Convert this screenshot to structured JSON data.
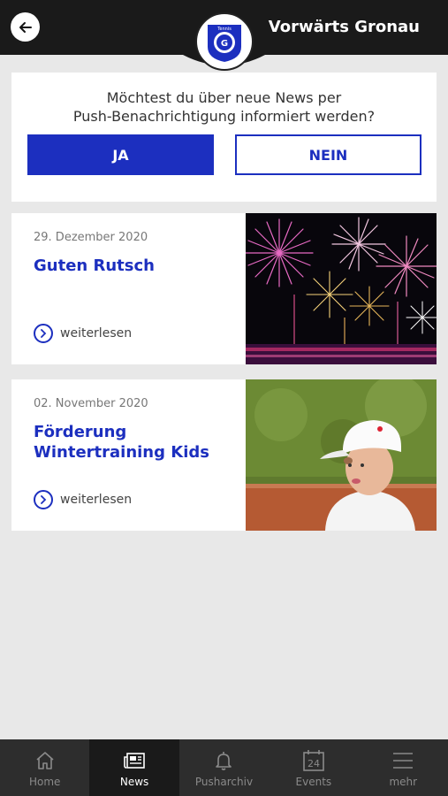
{
  "header": {
    "title": "Vorwärts Gronau",
    "logo_text": "Tennis"
  },
  "push_prompt": {
    "line1": "Möchtest du über neue News per",
    "line2": "Push-Benachrichtigung informiert werden?",
    "yes_label": "JA",
    "no_label": "NEIN"
  },
  "news": [
    {
      "date": "29. Dezember 2020",
      "title": "Guten Rutsch",
      "read_more": "weiterlesen",
      "image": "fireworks"
    },
    {
      "date": "02. November 2020",
      "title": "Förderung Wintertraining Kids",
      "read_more": "weiterlesen",
      "image": "kid-tennis"
    }
  ],
  "nav": [
    {
      "label": "Home",
      "icon": "home-icon",
      "active": false
    },
    {
      "label": "News",
      "icon": "news-icon",
      "active": true
    },
    {
      "label": "Pusharchiv",
      "icon": "bell-icon",
      "active": false
    },
    {
      "label": "Events",
      "icon": "calendar-icon",
      "active": false,
      "badge": "24"
    },
    {
      "label": "mehr",
      "icon": "menu-icon",
      "active": false
    }
  ],
  "colors": {
    "accent": "#1c2fbf",
    "header": "#1a1a1a",
    "nav": "#2d2d2d",
    "background": "#e8e8e8"
  }
}
